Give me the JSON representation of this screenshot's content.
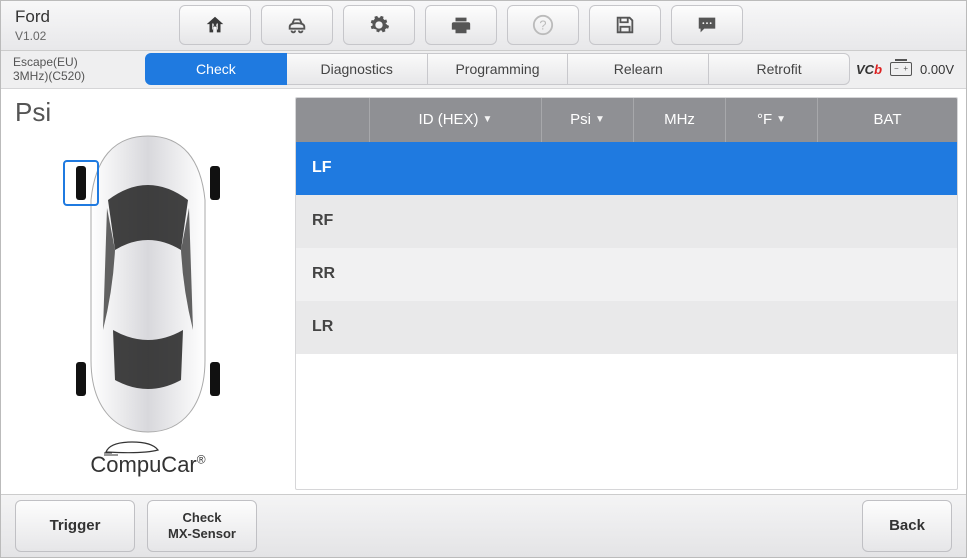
{
  "header": {
    "brand": "Ford",
    "version": "V1.02"
  },
  "toolbar_icons": [
    "home",
    "diag",
    "settings",
    "print",
    "help",
    "save",
    "chat"
  ],
  "vehicle": {
    "line1": "Escape(EU)",
    "line2": "3MHz)(C520)"
  },
  "tabs": [
    {
      "label": "Check",
      "active": true
    },
    {
      "label": "Diagnostics",
      "active": false
    },
    {
      "label": "Programming",
      "active": false
    },
    {
      "label": "Relearn",
      "active": false
    },
    {
      "label": "Retrofit",
      "active": false
    }
  ],
  "status": {
    "vci_prefix": "VC",
    "vci_suffix": "b",
    "voltage": "0.00V"
  },
  "unit_label": "Psi",
  "logo_text": "CompuCar",
  "logo_reg": "®",
  "table": {
    "headers": {
      "pos": "",
      "id": "ID (HEX)",
      "psi": "Psi",
      "mhz": "MHz",
      "temp": "°F",
      "bat": "BAT"
    },
    "rows": [
      {
        "pos": "LF",
        "id": "",
        "psi": "",
        "mhz": "",
        "temp": "",
        "bat": "",
        "selected": true
      },
      {
        "pos": "RF",
        "id": "",
        "psi": "",
        "mhz": "",
        "temp": "",
        "bat": "",
        "selected": false
      },
      {
        "pos": "RR",
        "id": "",
        "psi": "",
        "mhz": "",
        "temp": "",
        "bat": "",
        "selected": false
      },
      {
        "pos": "LR",
        "id": "",
        "psi": "",
        "mhz": "",
        "temp": "",
        "bat": "",
        "selected": false
      }
    ]
  },
  "buttons": {
    "trigger": "Trigger",
    "mx_line1": "Check",
    "mx_line2": "MX-Sensor",
    "back": "Back"
  }
}
